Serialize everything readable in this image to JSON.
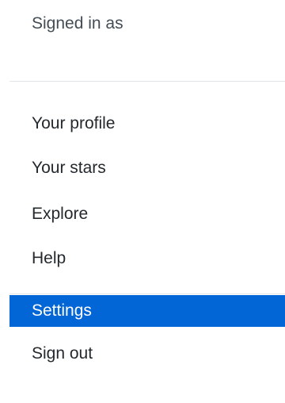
{
  "header": {
    "signed_in_label": "Signed in as"
  },
  "menu": {
    "items": [
      {
        "label": "Your profile"
      },
      {
        "label": "Your stars"
      },
      {
        "label": "Explore"
      },
      {
        "label": "Help"
      },
      {
        "label": "Settings",
        "active": true
      },
      {
        "label": "Sign out"
      }
    ]
  },
  "colors": {
    "active_background": "#0366d6",
    "active_text": "#ffffff",
    "text": "#24292e",
    "muted_text": "#444d56",
    "divider": "#e1e4e8"
  }
}
